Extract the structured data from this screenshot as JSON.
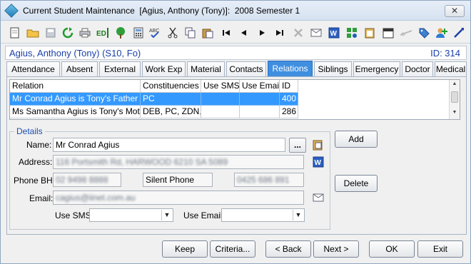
{
  "window": {
    "title": "Current Student Maintenance  [Agius, Anthony (Tony)]:  2008 Semester 1",
    "close_glyph": "✕"
  },
  "toolbar": {
    "icons": [
      "new-document-icon",
      "open-folder-icon",
      "save-icon",
      "refresh-icon",
      "print-icon",
      "edit-record-icon",
      "family-tree-icon",
      "calculator-icon",
      "spellcheck-icon",
      "cut-icon",
      "copy-icon",
      "paste-icon",
      "first-record-icon",
      "previous-record-icon",
      "next-record-icon",
      "last-record-icon",
      "delete-icon",
      "email-icon",
      "word-icon",
      "grid-settings-icon",
      "clipboard-icon",
      "calendar-icon",
      "link-icon",
      "tag-icon",
      "add-user-icon",
      "magic-wand-icon"
    ]
  },
  "student": {
    "name": "Agius, Anthony (Tony) (S10, Fo)",
    "id_text": "ID: 314"
  },
  "tabs": [
    "Attendance",
    "Absent",
    "External",
    "Work Exp",
    "Material",
    "Contacts",
    "Relations",
    "Siblings",
    "Emergency",
    "Doctor",
    "Medical"
  ],
  "active_tab": "Relations",
  "grid": {
    "headers": [
      "Relation",
      "Constituencies",
      "Use SMS",
      "Use Email",
      "ID"
    ],
    "rows": [
      [
        "Mr Conrad Agius is Tony's Father",
        "PC",
        "",
        "",
        "400"
      ],
      [
        "Ms Samantha Agius is Tony's Mother",
        "DEB, PC, ZDN, ZI",
        "",
        "",
        "286"
      ]
    ]
  },
  "details": {
    "legend": "Details",
    "name_label": "Name:",
    "name_value": "Mr Conrad Agius",
    "address_label": "Address:",
    "address_value": "116 Portsmith Rd, HARWOOD 6210 SA 5089",
    "phone_bh_label": "Phone BH:",
    "phone_bh_value": "02 9498 8888",
    "silent_phone_label": "Silent Phone",
    "phone2_value": "0425 686 891",
    "email_label": "Email:",
    "email_value": "cagius@iinet.com.au",
    "use_sms_label": "Use SMS:",
    "use_sms_value": "",
    "use_email_label": "Use Email:",
    "use_email_value": "",
    "browse_label": "..."
  },
  "side_buttons": {
    "add": "Add",
    "delete": "Delete"
  },
  "footer_buttons": {
    "keep": "Keep",
    "criteria": "Criteria...",
    "back": "< Back",
    "next": "Next >",
    "ok": "OK",
    "exit": "Exit"
  },
  "colors": {
    "selection": "#3399ff",
    "active_tab": "#3f8ee0",
    "student_text": "#1a3fa8",
    "legend_text": "#1a4fb0"
  }
}
